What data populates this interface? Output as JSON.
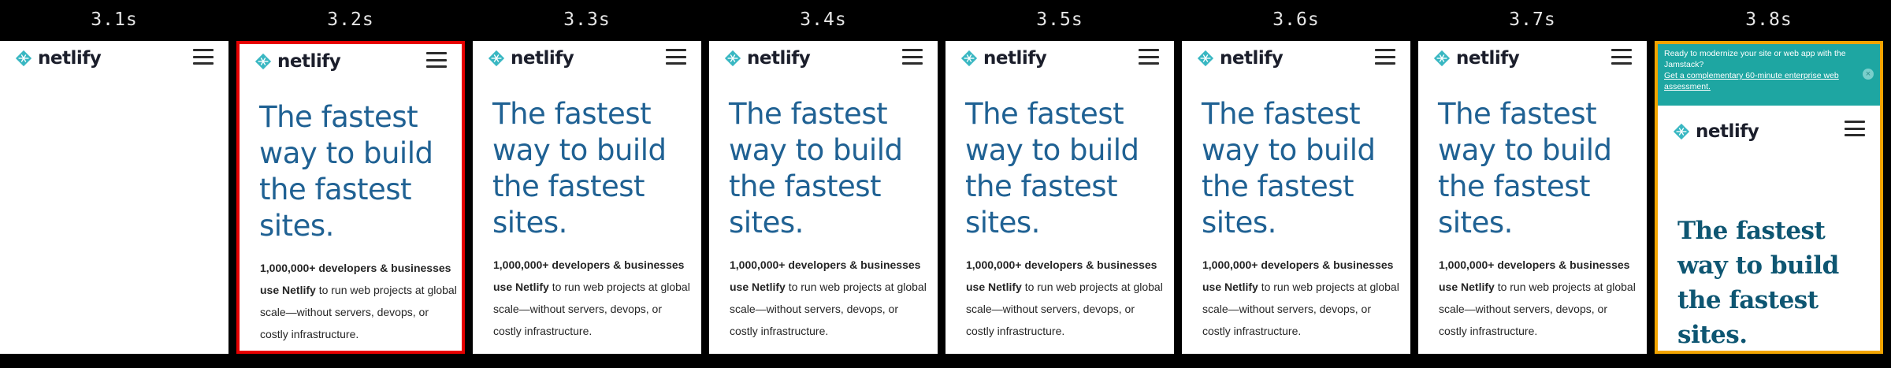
{
  "frames": [
    {
      "time": "3.1s",
      "brand": "netlify",
      "headline": "",
      "intro_bold": "",
      "intro_rest": "",
      "state": "blank"
    },
    {
      "time": "3.2s",
      "brand": "netlify",
      "headline": "The fastest way to build the fastest sites.",
      "intro_bold": "1,000,000+ developers & businesses use Netlify",
      "intro_rest": " to run web projects at global scale—without servers, devops, or costly infrastructure.",
      "state": "selected"
    },
    {
      "time": "3.3s",
      "brand": "netlify",
      "headline": "The fastest way to build the fastest sites.",
      "intro_bold": "1,000,000+ developers & businesses use Netlify",
      "intro_rest": " to run web projects at global scale—without servers, devops, or costly infrastructure.",
      "state": "default"
    },
    {
      "time": "3.4s",
      "brand": "netlify",
      "headline": "The fastest way to build the fastest sites.",
      "intro_bold": "1,000,000+ developers & businesses use Netlify",
      "intro_rest": " to run web projects at global scale—without servers, devops, or costly infrastructure.",
      "state": "default"
    },
    {
      "time": "3.5s",
      "brand": "netlify",
      "headline": "The fastest way to build the fastest sites.",
      "intro_bold": "1,000,000+ developers & businesses use Netlify",
      "intro_rest": " to run web projects at global scale—without servers, devops, or costly infrastructure.",
      "state": "default"
    },
    {
      "time": "3.6s",
      "brand": "netlify",
      "headline": "The fastest way to build the fastest sites.",
      "intro_bold": "1,000,000+ developers & businesses use Netlify",
      "intro_rest": " to run web projects at global scale—without servers, devops, or costly infrastructure.",
      "state": "default"
    },
    {
      "time": "3.7s",
      "brand": "netlify",
      "headline": "The fastest way to build the fastest sites.",
      "intro_bold": "1,000,000+ developers & businesses use Netlify",
      "intro_rest": " to run web projects at global scale—without servers, devops, or costly infrastructure.",
      "state": "default"
    },
    {
      "time": "3.8s",
      "brand": "netlify",
      "headline": "The fastest way to build the fastest sites.",
      "intro_bold": "",
      "intro_rest": "",
      "state": "final",
      "banner_text": "Ready to modernize your site or web app with the Jamstack?",
      "banner_link": "Get a complementary 60-minute enterprise web assessment.",
      "banner_close": "×"
    }
  ],
  "colors": {
    "headline": "#1f6193",
    "final_headline": "#0e5672",
    "selected_border": "#e60000",
    "final_border": "#f2a400",
    "banner": "#1ea6a2",
    "logo_mark": "#38b7c2"
  },
  "icons": {
    "logo": "netlify-logo-icon",
    "menu": "hamburger-menu-icon",
    "close": "close-icon"
  }
}
